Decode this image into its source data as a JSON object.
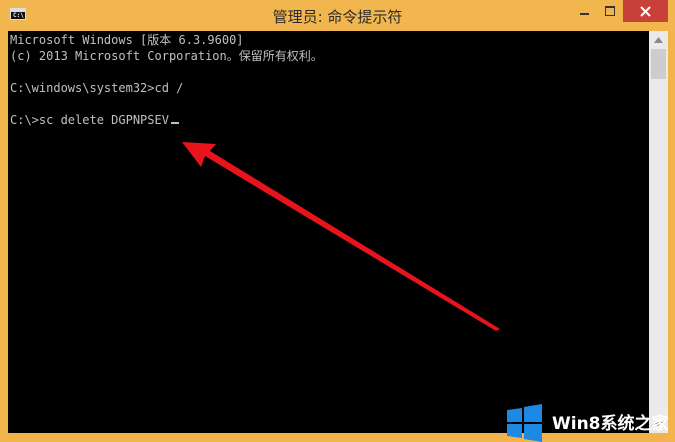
{
  "window": {
    "title": "管理员: 命令提示符",
    "icon_label": "C:\\",
    "accent_color": "#f2b64f",
    "close_color": "#c7403a"
  },
  "console": {
    "lines": [
      "Microsoft Windows [版本 6.3.9600]",
      "(c) 2013 Microsoft Corporation。保留所有权利。",
      "",
      "C:\\windows\\system32>cd /",
      "",
      "C:\\>sc delete DGPNPSEV"
    ],
    "text_color": "#c0c0c0",
    "background": "#000000"
  },
  "annotation": {
    "icon": "red-arrow-icon",
    "color": "#e8141b"
  },
  "watermark": {
    "text": "Win8系统之家",
    "icon": "windows-logo-icon",
    "color": "#1e88e5"
  }
}
